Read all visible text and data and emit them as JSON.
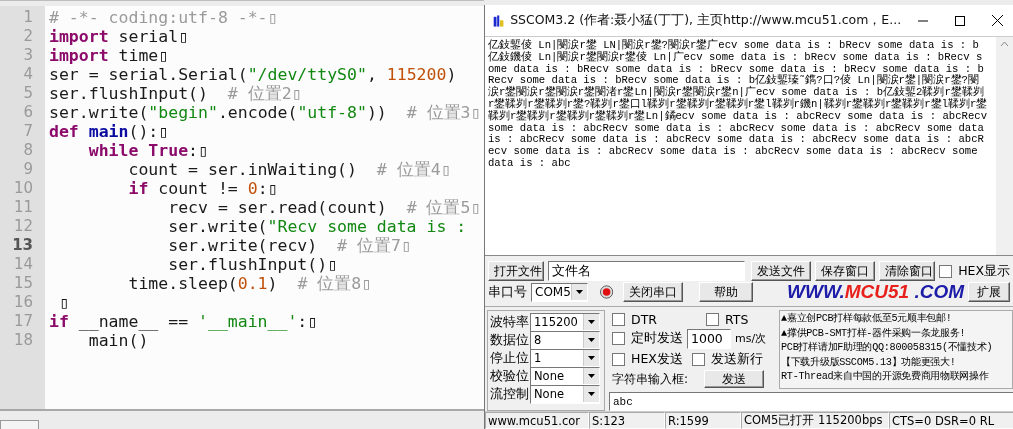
{
  "editor": {
    "lines": [
      {
        "number": "1",
        "current": false,
        "tokens": [
          {
            "kind": "comment",
            "text": "# -*- coding:utf-8 -*-▯"
          }
        ]
      },
      {
        "number": "2",
        "current": false,
        "tokens": [
          {
            "kind": "keyword",
            "text": "import"
          },
          {
            "kind": "plain",
            "text": " serial▯"
          }
        ]
      },
      {
        "number": "3",
        "current": false,
        "tokens": [
          {
            "kind": "keyword",
            "text": "import"
          },
          {
            "kind": "plain",
            "text": " time▯"
          }
        ]
      },
      {
        "number": "4",
        "current": false,
        "tokens": [
          {
            "kind": "plain",
            "text": "ser = serial.Serial("
          },
          {
            "kind": "string",
            "text": "\"/dev/ttyS0\""
          },
          {
            "kind": "plain",
            "text": ", "
          },
          {
            "kind": "number",
            "text": "115200"
          },
          {
            "kind": "plain",
            "text": ")"
          }
        ]
      },
      {
        "number": "5",
        "current": false,
        "tokens": [
          {
            "kind": "plain",
            "text": "ser.flushInput()  "
          },
          {
            "kind": "comment",
            "text": "# 位置2▯"
          }
        ]
      },
      {
        "number": "6",
        "current": false,
        "tokens": [
          {
            "kind": "plain",
            "text": "ser.write("
          },
          {
            "kind": "string",
            "text": "\"begin\""
          },
          {
            "kind": "plain",
            "text": ".encode("
          },
          {
            "kind": "string",
            "text": "\"utf-8\""
          },
          {
            "kind": "plain",
            "text": "))  "
          },
          {
            "kind": "comment",
            "text": "# 位置3▯"
          }
        ]
      },
      {
        "number": "7",
        "current": false,
        "tokens": [
          {
            "kind": "keyword",
            "text": "def"
          },
          {
            "kind": "funcname",
            "text": " main"
          },
          {
            "kind": "plain",
            "text": "():▯"
          }
        ]
      },
      {
        "number": "8",
        "current": false,
        "tokens": [
          {
            "kind": "keyword",
            "text": "    while True"
          },
          {
            "kind": "plain",
            "text": ":▯"
          }
        ]
      },
      {
        "number": "9",
        "current": false,
        "tokens": [
          {
            "kind": "plain",
            "text": "        count = ser.inWaiting()  "
          },
          {
            "kind": "comment",
            "text": "# 位置4▯"
          }
        ]
      },
      {
        "number": "10",
        "current": false,
        "tokens": [
          {
            "kind": "keyword",
            "text": "        if"
          },
          {
            "kind": "plain",
            "text": " count != "
          },
          {
            "kind": "number",
            "text": "0"
          },
          {
            "kind": "plain",
            "text": ":▯"
          }
        ]
      },
      {
        "number": "11",
        "current": false,
        "tokens": [
          {
            "kind": "plain",
            "text": "            recv = ser.read(count)  "
          },
          {
            "kind": "comment",
            "text": "# 位置5▯"
          }
        ]
      },
      {
        "number": "12",
        "current": false,
        "tokens": [
          {
            "kind": "plain",
            "text": "            ser.write("
          },
          {
            "kind": "string",
            "text": "\"Recv some data is :"
          }
        ]
      },
      {
        "number": "13",
        "current": true,
        "tokens": [
          {
            "kind": "plain",
            "text": "            ser.write(recv)  "
          },
          {
            "kind": "comment",
            "text": "# 位置7▯"
          }
        ]
      },
      {
        "number": "14",
        "current": false,
        "tokens": [
          {
            "kind": "plain",
            "text": "            ser.flushInput()▯"
          }
        ]
      },
      {
        "number": "15",
        "current": false,
        "tokens": [
          {
            "kind": "plain",
            "text": "        time.sleep("
          },
          {
            "kind": "number",
            "text": "0.1"
          },
          {
            "kind": "plain",
            "text": ")  "
          },
          {
            "kind": "comment",
            "text": "# 位置8▯"
          }
        ]
      },
      {
        "number": "16",
        "current": false,
        "tokens": [
          {
            "kind": "plain",
            "text": " ▯"
          }
        ]
      },
      {
        "number": "17",
        "current": false,
        "tokens": [
          {
            "kind": "keyword",
            "text": "if"
          },
          {
            "kind": "plain",
            "text": " __name__ == "
          },
          {
            "kind": "string",
            "text": "'__main__'"
          },
          {
            "kind": "plain",
            "text": ":▯"
          }
        ]
      },
      {
        "number": "18",
        "current": false,
        "tokens": [
          {
            "kind": "plain",
            "text": "    main()"
          }
        ]
      }
    ]
  },
  "sscom": {
    "title": "SSCOM3.2 (作者:聂小猛(丁丁), 主页http://www.mcu51.com，E...",
    "receive_text": "亿鈙鏨倰 Ln|閿涙r鐢 LN|閿涙r鐢?閿涙r鐢广ecv some data is : bRecv some data is : b亿鈙鐖倰 Ln|閿涙r鐢閿涙r鐢倰 Ln|广ecv some data is : bRecv some data is : bRecv some data is : bRecv some data is : bRecv some data is : bRecv some data is : bRecv some data is : bRecv some data is : b亿鈙鏨瑧˜鐫?口?倰 Ln|閿涙r鐢|閿涙r鐢?閿涙r鐢閿涙r鐢閿涙r鐢閿渚r鐢Ln|閿涙r鐢閿涙r鐢n|广ecv some data is : b亿鈙鏨2鞣刿r鐢鞣刿r鐢鞣刿r鐢鞣刿r鐢?鞣刿r鐢口l鞣刿r鐢鞣刿r鐢鞣刿r鐢l鞣刿r鐖n|鞣刿r鐢鞣刿r鐢鞣刿r鐢l鞣刿r鐢鞣刿r鐢鞣刿r鐢鞣刿r鐢鞣刿r鐢Ln|鐍ecv some data is : abcRecv some data is : abcRecv some data is : abcRecv some data is : abcRecv some data is : abcRecv some data is : abcRecv some data is : abcRecv some data is : abcRecv some data is : abcRecv some data is : abcRecv some data is : abcRecv some data is : abcRecv some data is : abc",
    "open_file_button": "打开文件",
    "file_field": {
      "value": "文件名"
    },
    "send_file_button": "发送文件",
    "save_window_button": "保存窗口",
    "clear_window_button": "清除窗口",
    "hex_display": {
      "label": "HEX显示",
      "checked": false
    },
    "port_label": "串口号",
    "port_select": "COM5",
    "port_open": true,
    "close_port_button": "关闭串口",
    "help_button": "帮助",
    "logo": [
      {
        "text": "WWW.",
        "color": "#1c1ca8"
      },
      {
        "text": "MCU51",
        "color": "#e8201c"
      },
      {
        "text": " .COM",
        "color": "#1c1ca8"
      }
    ],
    "expand_button": "扩展",
    "settings": [
      {
        "label": "波特率",
        "value": "115200"
      },
      {
        "label": "数据位",
        "value": "8"
      },
      {
        "label": "停止位",
        "value": "1"
      },
      {
        "label": "校验位",
        "value": "None"
      },
      {
        "label": "流控制",
        "value": "None"
      }
    ],
    "dtr": {
      "label": "DTR",
      "checked": false
    },
    "rts": {
      "label": "RTS",
      "checked": false
    },
    "timed_send": {
      "label": "定时发送",
      "checked": false
    },
    "interval_field": {
      "value": "1000"
    },
    "interval_unit": "ms/次",
    "hex_send": {
      "label": "HEX发送",
      "checked": false
    },
    "send_newline": {
      "label": "发送新行",
      "checked": false
    },
    "input_label": "字符串输入框:",
    "send_button": "发送",
    "ads": [
      "▲嘉立创PCB打样每款低至5元顺丰包邮!",
      "▲撑供PCB-SMT打样-器件采购一条龙服务!",
      "PCB打样请加F助理的QQ:800058315(不懂技术)",
      "【下载升级版SSCOM5.13】功能更强大!",
      "RT-Thread来自中国的开源免费商用物联网操作"
    ],
    "input_field": {
      "value": "abc"
    },
    "status_bar": [
      "www.mcu51.cor",
      "S:123",
      "R:1599",
      "COM5已打开  115200bps",
      "CTS=0 DSR=0 RL"
    ]
  }
}
